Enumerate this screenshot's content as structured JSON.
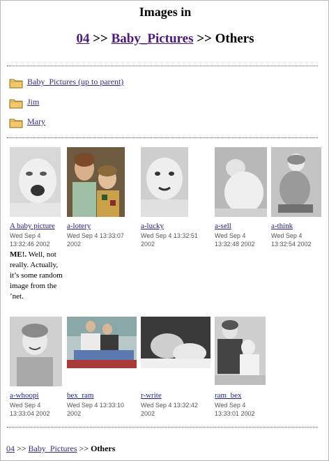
{
  "header": {
    "title": "Images in",
    "crumbs": [
      "04",
      "Baby_Pictures",
      "Others"
    ],
    "sep": ">>"
  },
  "folders": [
    {
      "label": "Baby_Pictures (up to parent)"
    },
    {
      "label": "Jim"
    },
    {
      "label": "Mary"
    }
  ],
  "images": [
    {
      "name": "A baby picture",
      "date": "Wed Sep 4",
      "time": "13:32:46 2002"
    },
    {
      "name": "a-lotery",
      "date": "Wed Sep 4 13:33:07",
      "time": "2002"
    },
    {
      "name": "a-lucky",
      "date": "Wed Sep 4 13:32:51",
      "time": "2002"
    },
    {
      "name": "a-sell",
      "date": "Wed Sep 4",
      "time": "13:32:48 2002"
    },
    {
      "name": "a-think",
      "date": "Wed Sep 4",
      "time": "13:32:54 2002"
    },
    {
      "name": "a-whoopi",
      "date": "Wed Sep 4",
      "time": "13:33:04 2002"
    },
    {
      "name": "bex_ram",
      "date": "Wed Sep 4 13:33:10",
      "time": "2002"
    },
    {
      "name": "r-write",
      "date": "Wed Sep 4 13:32:42",
      "time": "2002"
    },
    {
      "name": "ram_bex",
      "date": "Wed Sep 4",
      "time": "13:33:01 2002"
    }
  ],
  "description": {
    "bold": "ME!.",
    "rest": " Well, not really. Actually, it’s some random image from the ’net."
  },
  "footer": {
    "crumbs": [
      "04",
      "Baby_Pictures",
      "Others"
    ],
    "sep": ">>"
  }
}
